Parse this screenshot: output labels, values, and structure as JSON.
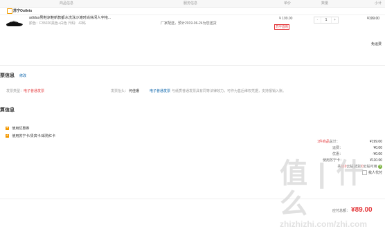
{
  "columns": {
    "info": "商品信息",
    "service": "服务信息",
    "price": "单价",
    "qty": "数量",
    "subtotal": "小计"
  },
  "shop": {
    "name": "苏宁Outlets"
  },
  "item": {
    "title": "adidas男鞋凉鞋新款都水洗泳沙滩时尚休闲人字拖...",
    "attrs": "颜色：F35020黑色+白色   尺码：42码",
    "service": "厂家配送，预计2019-06-24为您送货",
    "price": "¥ 199.00",
    "tag": "苏宁直购",
    "qty": "1",
    "minus": "-",
    "plus": "+",
    "subtotal": "¥199.00",
    "freight": "免运费"
  },
  "invoice": {
    "title": "票信息",
    "edit": "修改",
    "type_label": "发票类型：",
    "type_value": "电子普通发票",
    "head_label": "发票抬头：",
    "head_value": "何佳珊",
    "notice_link": "电子普通发票",
    "notice_text": "与纸质普通发票具有同等法律效力，可作为售后维权凭据，支持报销入账。"
  },
  "settle": {
    "title": "算信息",
    "coupon": "使用优惠券",
    "card": "使用苏宁卡/贵宾卡/采购红卡"
  },
  "summary": {
    "goods_label_pre": "1件商品",
    "goods_label": "总计：",
    "goods_value": "¥199.00",
    "freight_label": "运费：",
    "freight_value": "¥0.00",
    "discount_label": "优惠：",
    "discount_value": "-¥0.00",
    "used_label": "使用苏宁卡：",
    "used_value": "¥110.00",
    "points_pre": "共",
    "points_num": "110",
    "points_mid": "云钻,抵扣",
    "points_num2": "0",
    "points_post": "云钻可用",
    "help": "?",
    "agent": "找人代付",
    "payable_label": "应付总额：",
    "payable_value": "¥89.00"
  },
  "watermark": {
    "cn": "值 | 什么",
    "en": "zhizhizhi.com/zhi.com"
  }
}
